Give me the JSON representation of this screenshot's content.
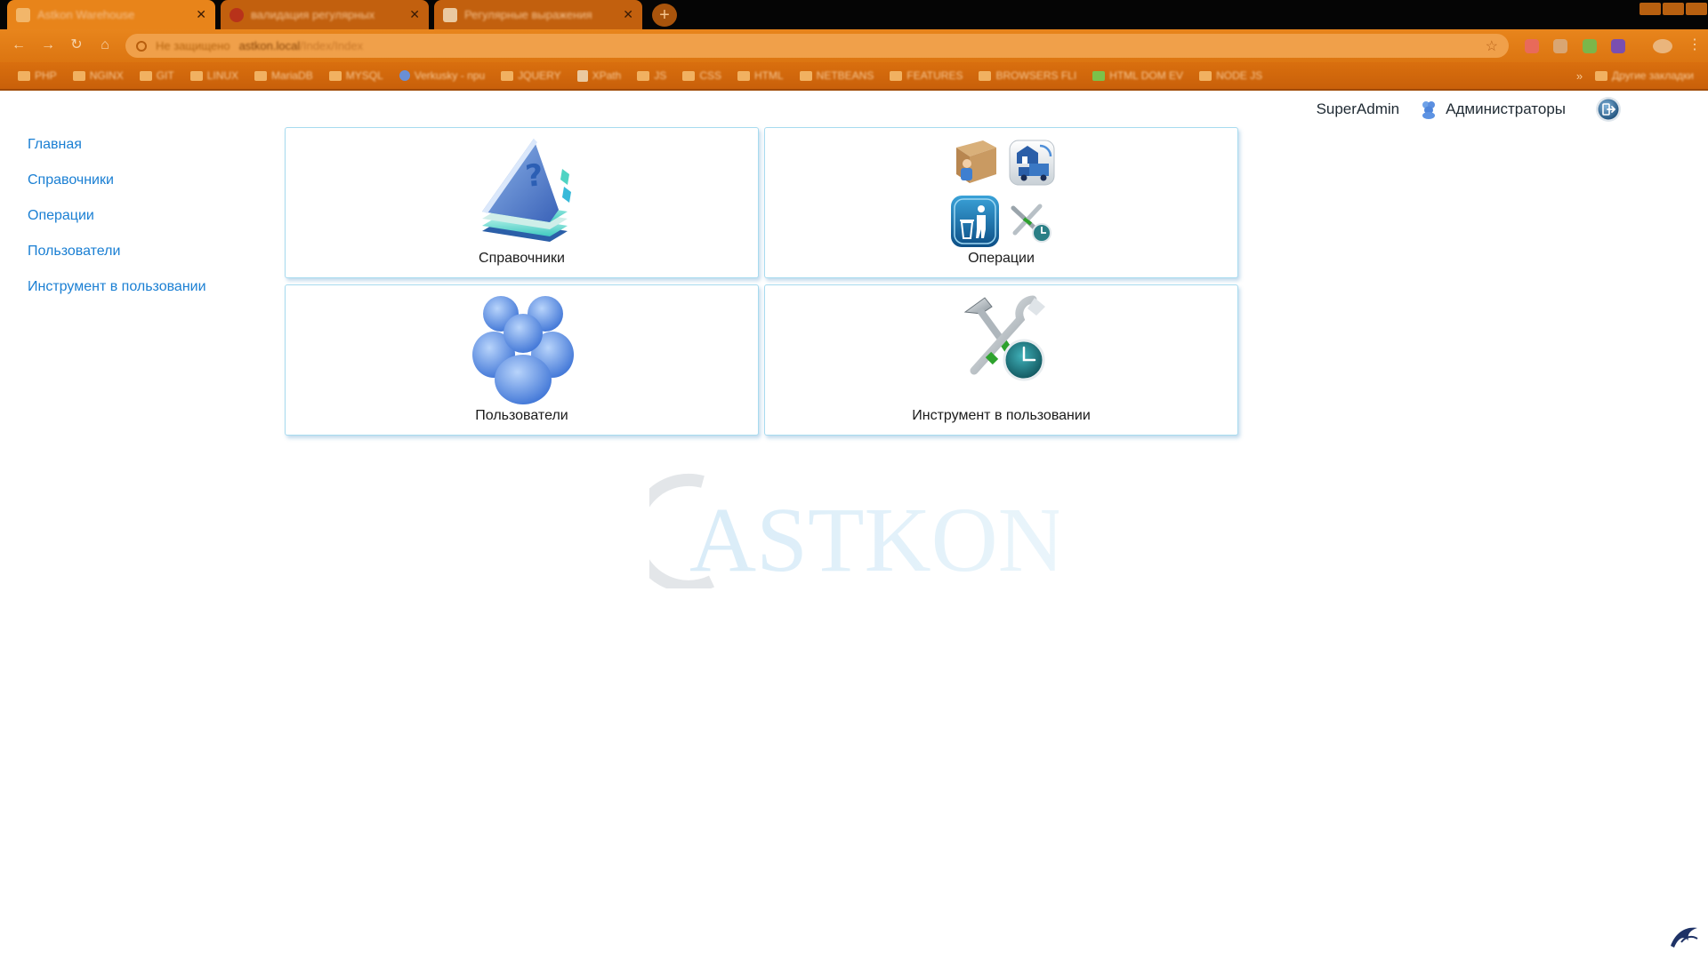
{
  "browser": {
    "tabs": [
      {
        "title": "Astkon Warehouse",
        "active": true
      },
      {
        "title": "валидация регулярных",
        "active": false
      },
      {
        "title": "Регулярные выражения",
        "active": false
      }
    ],
    "new_tab_label": "+",
    "address": {
      "security": "Не защищено",
      "host": "astkon.local",
      "path": "/Index/Index"
    },
    "bookmarks": [
      "PHP",
      "NGINX",
      "GIT",
      "LINUX",
      "MariaDB",
      "MYSQL",
      "Verkusky - npu",
      "JQUERY",
      "XPath",
      "JS",
      "CSS",
      "HTML",
      "NETBEANS",
      "FEATURES",
      "BROWSERS FLI",
      "HTML DOM EV",
      "NODE JS"
    ],
    "bookmarks_more": "Другие закладки",
    "chevron": "»"
  },
  "header": {
    "username": "SuperAdmin",
    "group": "Администраторы"
  },
  "sidebar": {
    "items": [
      {
        "label": "Главная"
      },
      {
        "label": "Справочники"
      },
      {
        "label": "Операции"
      },
      {
        "label": "Пользователи"
      },
      {
        "label": "Инструмент в пользовании"
      }
    ]
  },
  "tiles": [
    {
      "label": "Справочники",
      "icon": "reference-book-icon"
    },
    {
      "label": "Операции",
      "icon": "operations-icon"
    },
    {
      "label": "Пользователи",
      "icon": "users-icon"
    },
    {
      "label": "Инструмент в пользовании",
      "icon": "tools-in-use-icon"
    }
  ],
  "watermark": {
    "text": "ASTKON"
  },
  "colors": {
    "accent": "#1a7fd3",
    "tile_border": "#a8dbef",
    "chrome": "#e8841a"
  }
}
